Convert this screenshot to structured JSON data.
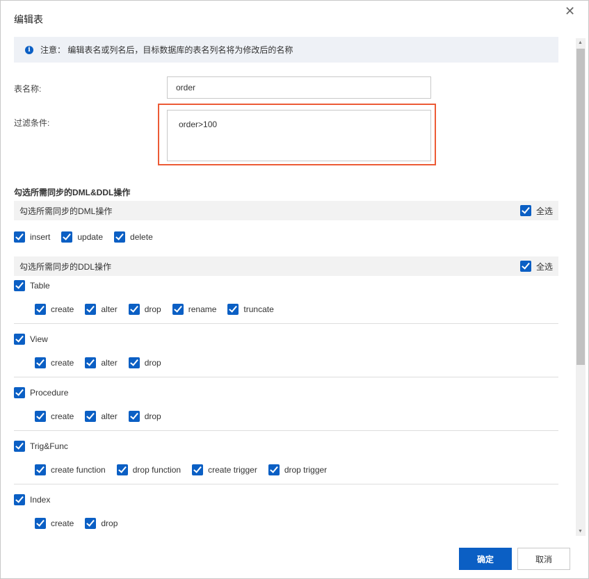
{
  "dialog": {
    "title": "编辑表",
    "close_icon": "close-icon"
  },
  "notice": {
    "text": "注意： 编辑表名或列名后，目标数据库的表名列名将为修改后的名称",
    "icon": "info-icon"
  },
  "form": {
    "table_name_label": "表名称:",
    "table_name_value": "order",
    "filter_label": "过滤条件:",
    "filter_value": "order>100"
  },
  "ops": {
    "section_title": "勾选所需同步的DML&DDL操作",
    "dml": {
      "title": "勾选所需同步的DML操作",
      "select_all": "全选",
      "items": [
        "insert",
        "update",
        "delete"
      ]
    },
    "ddl": {
      "title": "勾选所需同步的DDL操作",
      "select_all": "全选",
      "groups": [
        {
          "name": "Table",
          "items": [
            "create",
            "alter",
            "drop",
            "rename",
            "truncate"
          ]
        },
        {
          "name": "View",
          "items": [
            "create",
            "alter",
            "drop"
          ]
        },
        {
          "name": "Procedure",
          "items": [
            "create",
            "alter",
            "drop"
          ]
        },
        {
          "name": "Trig&Func",
          "items": [
            "create function",
            "drop function",
            "create trigger",
            "drop trigger"
          ]
        },
        {
          "name": "Index",
          "items": [
            "create",
            "drop"
          ]
        }
      ]
    }
  },
  "footer": {
    "ok": "确定",
    "cancel": "取消"
  },
  "colors": {
    "accent": "#0b5fc4",
    "highlight": "#ec5a35"
  }
}
